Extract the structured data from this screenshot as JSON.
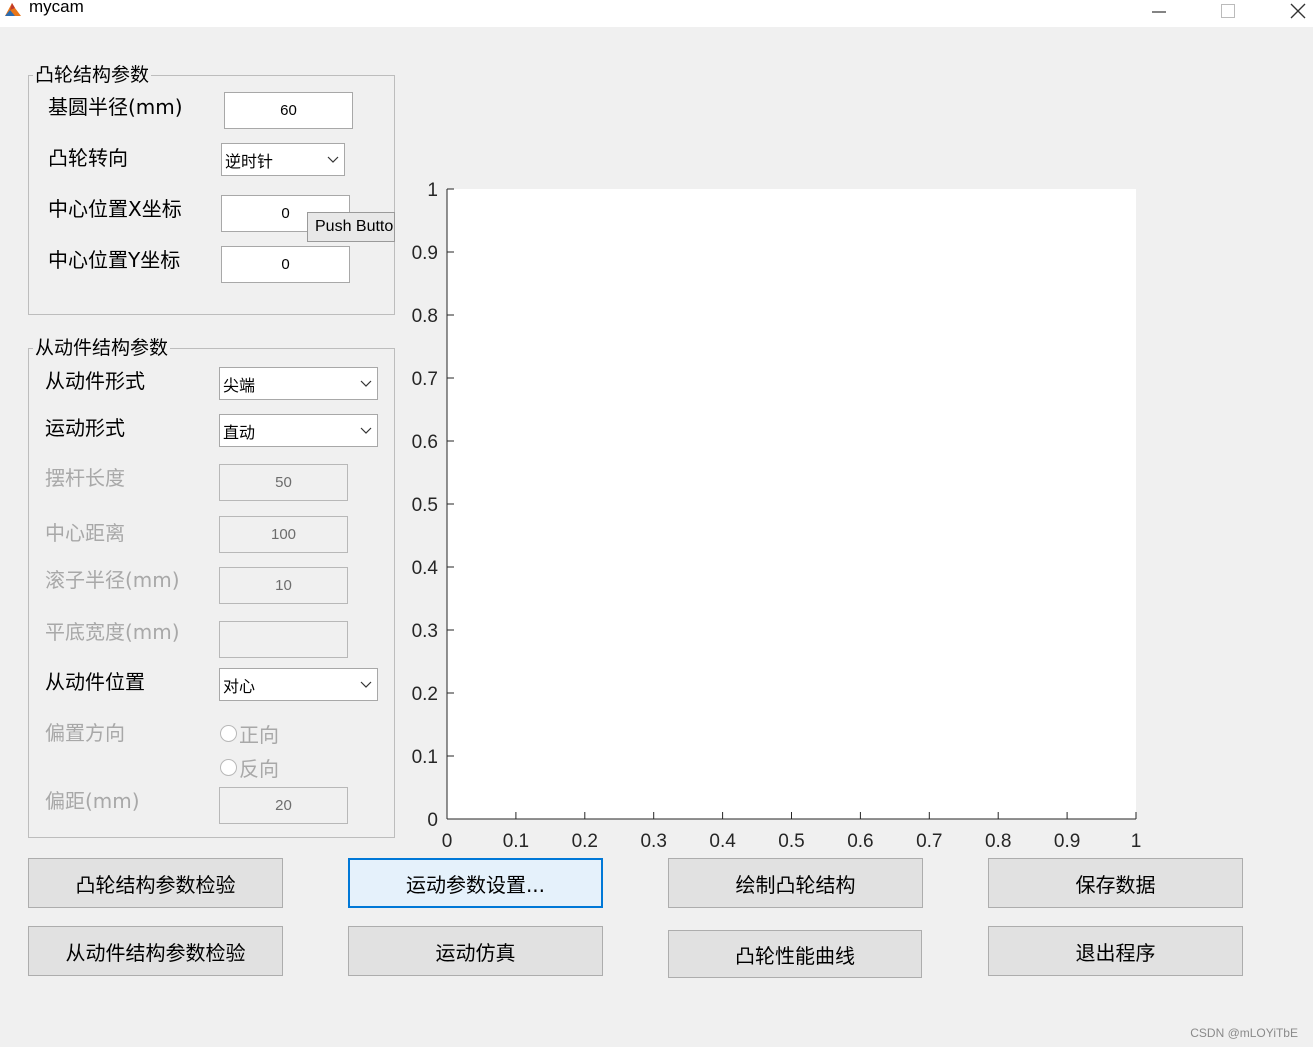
{
  "window": {
    "title": "mycam"
  },
  "cam_panel": {
    "title": "凸轮结构参数",
    "base_radius_label": "基圆半径(mm)",
    "base_radius_value": "60",
    "rotation_label": "凸轮转向",
    "rotation_value": "逆时针",
    "center_x_label": "中心位置X坐标",
    "center_x_value": "0",
    "center_y_label": "中心位置Y坐标",
    "center_y_value": "0",
    "tooltip": "Push Button"
  },
  "follower_panel": {
    "title": "从动件结构参数",
    "form_label": "从动件形式",
    "form_value": "尖端",
    "motion_label": "运动形式",
    "motion_value": "直动",
    "rocker_length_label": "摆杆长度",
    "rocker_length_value": "50",
    "center_distance_label": "中心距离",
    "center_distance_value": "100",
    "roller_radius_label": "滚子半径(mm)",
    "roller_radius_value": "10",
    "flat_width_label": "平底宽度(mm)",
    "flat_width_value": "",
    "position_label": "从动件位置",
    "position_value": "对心",
    "offset_dir_label": "偏置方向",
    "offset_dir_options": [
      "正向",
      "反向"
    ],
    "offset_label": "偏距(mm)",
    "offset_value": "20"
  },
  "axes": {
    "x_ticks": [
      "0",
      "0.1",
      "0.2",
      "0.3",
      "0.4",
      "0.5",
      "0.6",
      "0.7",
      "0.8",
      "0.9",
      "1"
    ],
    "y_ticks": [
      "0",
      "0.1",
      "0.2",
      "0.3",
      "0.4",
      "0.5",
      "0.6",
      "0.7",
      "0.8",
      "0.9",
      "1"
    ],
    "xlim": [
      0,
      1
    ],
    "ylim": [
      0,
      1
    ]
  },
  "buttons": {
    "check_cam": "凸轮结构参数检验",
    "motion_settings": "运动参数设置...",
    "draw_cam": "绘制凸轮结构",
    "save_data": "保存数据",
    "check_follower": "从动件结构参数检验",
    "simulate": "运动仿真",
    "cam_curves": "凸轮性能曲线",
    "exit": "退出程序"
  },
  "watermark": "CSDN @mLOYiTbE",
  "colors": {
    "focus_border": "#0078d7",
    "button_bg": "#e1e1e1",
    "window_bg": "#f0f0f0"
  }
}
